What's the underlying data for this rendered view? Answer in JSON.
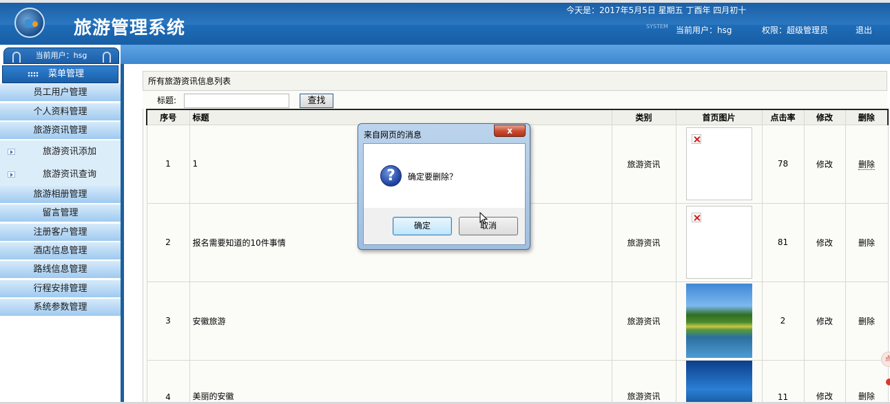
{
  "header": {
    "title": "旅游管理系统",
    "date_text": "今天是：2017年5月5日 星期五 丁酉年 四月初十",
    "system_word": "SYSTEM",
    "current_user_text": "当前用户：hsg",
    "role_text": "权限：超级管理员",
    "logout_label": "退出"
  },
  "sidebar": {
    "current_user_tab": "当前用户：hsg",
    "menu_head": "菜单管理",
    "items": [
      {
        "label": "员工用户管理"
      },
      {
        "label": "个人资料管理"
      },
      {
        "label": "旅游资讯管理"
      },
      {
        "label": "旅游资讯添加"
      },
      {
        "label": "旅游资讯查询"
      },
      {
        "label": "旅游相册管理"
      },
      {
        "label": "留言管理"
      },
      {
        "label": "注册客户管理"
      },
      {
        "label": "酒店信息管理"
      },
      {
        "label": "路线信息管理"
      },
      {
        "label": "行程安排管理"
      },
      {
        "label": "系统参数管理"
      }
    ]
  },
  "main": {
    "panel_title": "所有旅游资讯信息列表",
    "search_label": "标题:",
    "search_value": "",
    "search_button": "查找",
    "columns": [
      "序号",
      "标题",
      "类别",
      "首页图片",
      "点击率",
      "修改",
      "删除"
    ],
    "rows": [
      {
        "no": "1",
        "title": "1",
        "category": "旅游资讯",
        "image": "broken",
        "clicks": "78",
        "edit": "修改",
        "delete": "删除"
      },
      {
        "no": "2",
        "title": "报名需要知道的10件事情",
        "category": "旅游资讯",
        "image": "broken",
        "clicks": "81",
        "edit": "修改",
        "delete": "删除"
      },
      {
        "no": "3",
        "title": "安徽旅游",
        "category": "旅游资讯",
        "image": "lake-photo",
        "clicks": "2",
        "edit": "修改",
        "delete": "删除"
      },
      {
        "no": "4",
        "title": "美丽的安徽",
        "category": "旅游资讯",
        "image": "blue-sky-photo",
        "clicks": "11",
        "edit": "修改",
        "delete": "删除"
      }
    ]
  },
  "dialog": {
    "title": "来自网页的消息",
    "close_label": "x",
    "icon": "question-icon",
    "message": "确定要删除？",
    "ok_label": "确定",
    "cancel_label": "取消"
  },
  "float": {
    "label": "点"
  }
}
